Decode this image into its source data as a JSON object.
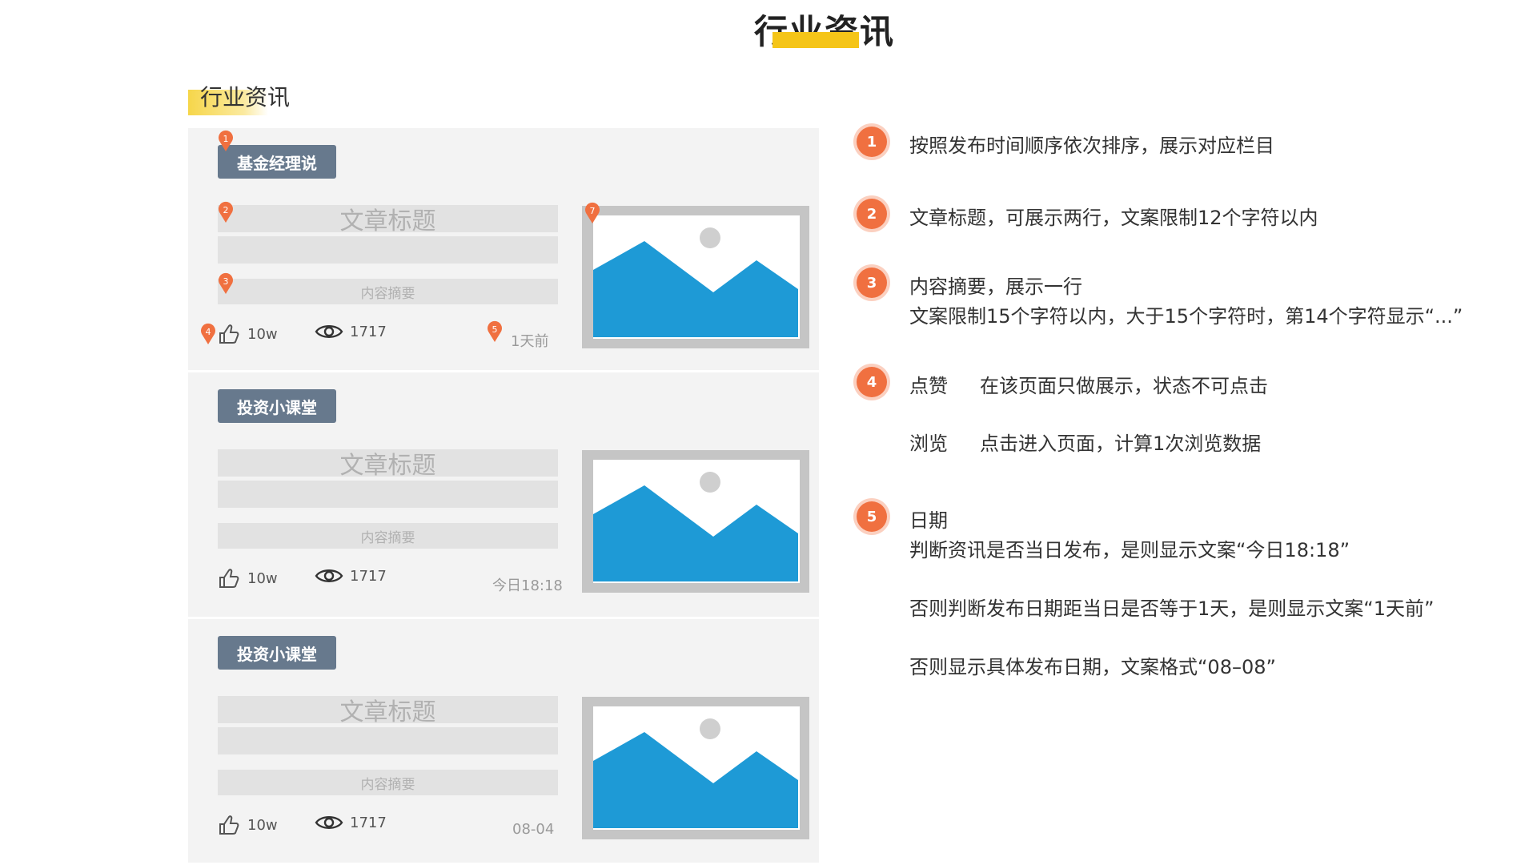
{
  "page_title": "行业资讯",
  "section_title": "行业资讯",
  "cards": [
    {
      "tag": "基金经理说",
      "title": "文章标题",
      "summary": "内容摘要",
      "likes": "10w",
      "views": "1717",
      "date": "1天前"
    },
    {
      "tag": "投资小课堂",
      "title": "文章标题",
      "summary": "内容摘要",
      "likes": "10w",
      "views": "1717",
      "date": "今日18:18"
    },
    {
      "tag": "投资小课堂",
      "title": "文章标题",
      "summary": "内容摘要",
      "likes": "10w",
      "views": "1717",
      "date": "08-04"
    }
  ],
  "markers": [
    "1",
    "2",
    "3",
    "4",
    "5",
    "7"
  ],
  "notes": [
    {
      "num": "1",
      "lines": [
        "按照发布时间顺序依次排序，展示对应栏目"
      ]
    },
    {
      "num": "2",
      "lines": [
        "文章标题，可展示两行，文案限制12个字符以内"
      ]
    },
    {
      "num": "3",
      "lines": [
        "内容摘要，展示一行",
        "文案限制15个字符以内，大于15个字符时，第14个字符显示“...”"
      ]
    },
    {
      "num": "4",
      "like_label": "点赞",
      "like_text": "在该页面只做展示，状态不可点击",
      "view_label": "浏览",
      "view_text": "点击进入页面，计算1次浏览数据"
    },
    {
      "num": "5",
      "lines": [
        "日期",
        "判断资讯是否当日发布，是则显示文案“今日18:18”",
        "否则判断发布日期距当日是否等于1天，是则显示文案“1天前”",
        "否则显示具体发布日期，文案格式“08–08”"
      ]
    }
  ],
  "colors": {
    "accent": "#f5c518",
    "tag_bg": "#67798d",
    "marker": "#f07040",
    "image_blue": "#1e9ad6"
  }
}
